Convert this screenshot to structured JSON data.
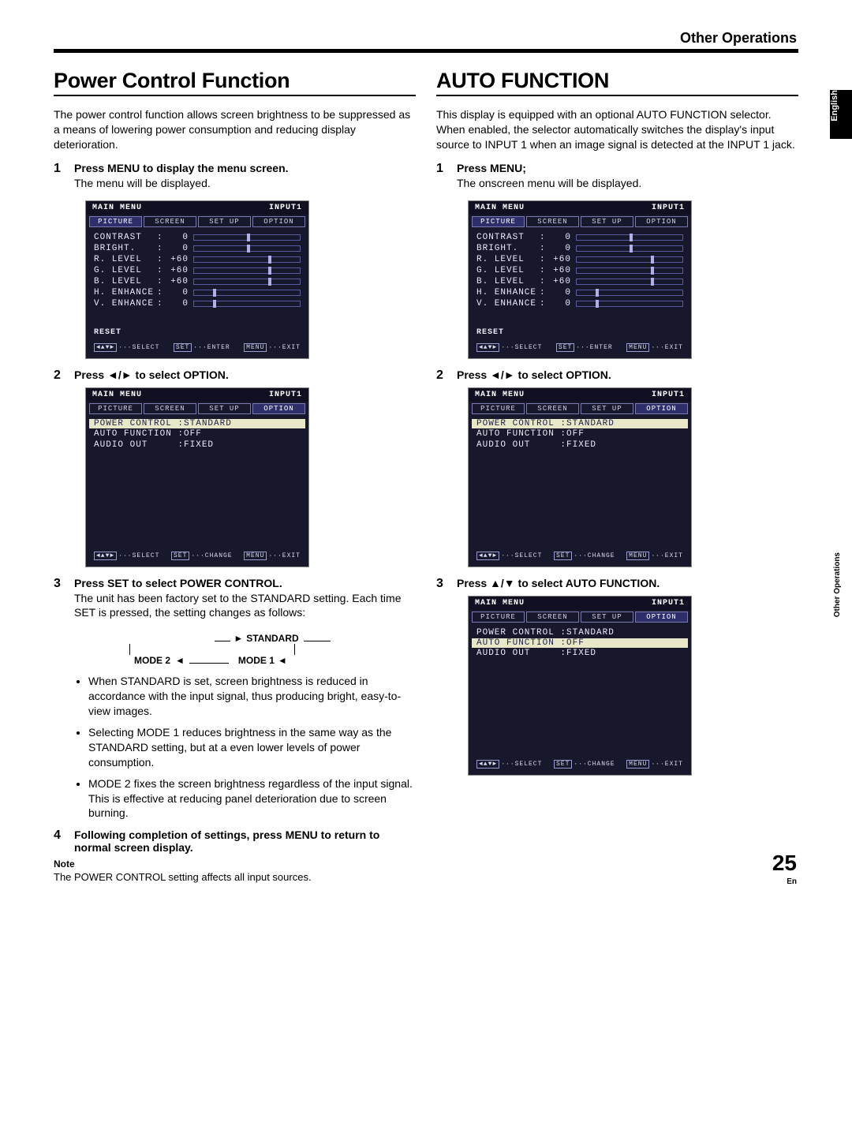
{
  "section_header": "Other Operations",
  "side_tab": "English",
  "side_tab2": "Other Operations",
  "page_number": "25",
  "page_sub": "En",
  "left": {
    "title": "Power Control Function",
    "lead": "The power control function allows screen brightness to be suppressed as a means of lowering power consumption and reducing display deterioration.",
    "step1_num": "1",
    "step1_head": "Press MENU to display the menu screen.",
    "step1_desc": "The menu will be displayed.",
    "step2_num": "2",
    "step2_head": "Press ◄/► to select OPTION.",
    "step3_num": "3",
    "step3_head": "Press SET to select POWER CONTROL.",
    "step3_desc": "The unit has been factory set to the STANDARD setting. Each time SET is pressed, the setting changes as follows:",
    "cycle": {
      "a": "STANDARD",
      "b": "MODE 1",
      "c": "MODE 2"
    },
    "bullet1": "When STANDARD is set, screen brightness is reduced in accordance with the input signal, thus producing bright, easy-to-view images.",
    "bullet2": "Selecting MODE 1 reduces brightness in the same way as the STANDARD setting, but at a even lower levels of power consumption.",
    "bullet3": "MODE 2 fixes the screen brightness regardless of the input signal. This is effective at reducing panel deterioration due to screen burning.",
    "step4_num": "4",
    "step4_head": "Following completion of settings, press MENU to return to normal screen display.",
    "note_label": "Note",
    "note_text": "The POWER CONTROL setting affects all input sources."
  },
  "right": {
    "title": "AUTO FUNCTION",
    "lead": "This display is equipped with an optional AUTO FUNCTION selector. When enabled, the selector automatically switches the display's input source to INPUT 1 when an image signal is detected at the INPUT 1 jack.",
    "step1_num": "1",
    "step1_head": "Press MENU;",
    "step1_desc": "The onscreen menu will be displayed.",
    "step2_num": "2",
    "step2_head": "Press ◄/► to select OPTION.",
    "step3_num": "3",
    "step3_head": "Press ▲/▼ to select AUTO FUNCTION."
  },
  "osd_picture": {
    "title": "MAIN  MENU",
    "input": "INPUT1",
    "tabs": [
      "PICTURE",
      "SCREEN",
      "SET UP",
      "OPTION"
    ],
    "active_tab": 0,
    "rows": [
      {
        "label": "CONTRAST",
        "val": "0",
        "pos": 50
      },
      {
        "label": "BRIGHT.",
        "val": "0",
        "pos": 50
      },
      {
        "label": "R. LEVEL",
        "val": "+60",
        "pos": 70
      },
      {
        "label": "G. LEVEL",
        "val": "+60",
        "pos": 70
      },
      {
        "label": "B. LEVEL",
        "val": "+60",
        "pos": 70
      },
      {
        "label": "H. ENHANCE",
        "val": "0",
        "pos": 18
      },
      {
        "label": "V. ENHANCE",
        "val": "0",
        "pos": 18
      }
    ],
    "reset": "RESET",
    "hints": {
      "select": "SELECT",
      "enter": "ENTER",
      "exit": "EXIT",
      "set": "SET",
      "menu": "MENU"
    }
  },
  "osd_option": {
    "title": "MAIN  MENU",
    "input": "INPUT1",
    "tabs": [
      "PICTURE",
      "SCREEN",
      "SET UP",
      "OPTION"
    ],
    "active_tab": 3,
    "lines": [
      {
        "text": "POWER CONTROL :STANDARD",
        "sel": true
      },
      {
        "text": "AUTO FUNCTION :OFF",
        "sel": false
      },
      {
        "text": "AUDIO OUT     :FIXED",
        "sel": false
      }
    ],
    "hints": {
      "select": "SELECT",
      "change": "CHANGE",
      "exit": "EXIT",
      "set": "SET",
      "menu": "MENU"
    }
  },
  "osd_option_auto": {
    "title": "MAIN  MENU",
    "input": "INPUT1",
    "tabs": [
      "PICTURE",
      "SCREEN",
      "SET UP",
      "OPTION"
    ],
    "active_tab": 3,
    "lines": [
      {
        "text": "POWER CONTROL :STANDARD",
        "sel": false
      },
      {
        "text": "AUTO FUNCTION :OFF",
        "sel": true
      },
      {
        "text": "AUDIO OUT     :FIXED",
        "sel": false
      }
    ],
    "hints": {
      "select": "SELECT",
      "change": "CHANGE",
      "exit": "EXIT",
      "set": "SET",
      "menu": "MENU"
    }
  }
}
